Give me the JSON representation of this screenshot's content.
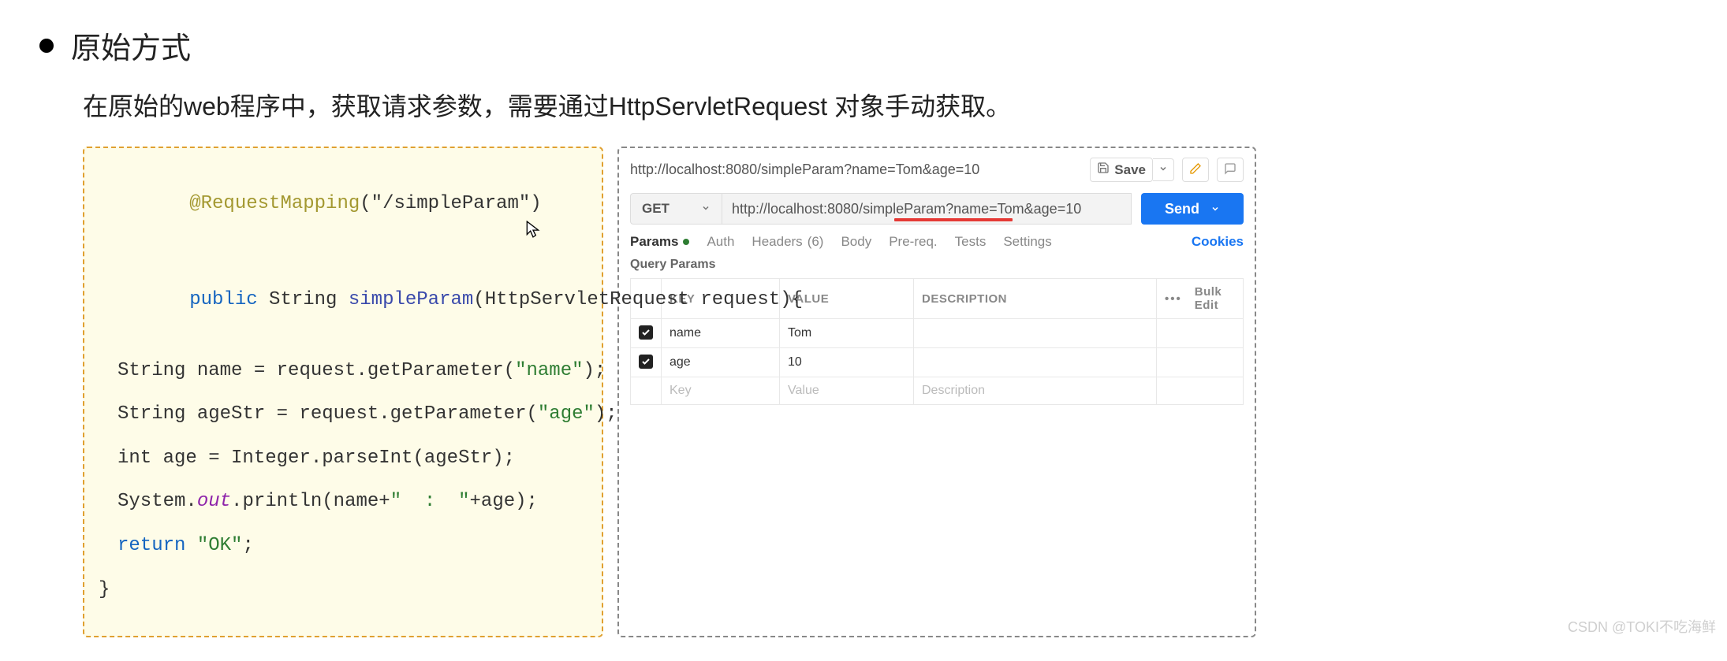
{
  "heading": "原始方式",
  "description": "在原始的web程序中，获取请求参数，需要通过HttpServletRequest 对象手动获取。",
  "code": {
    "annotation": "@RequestMapping",
    "mapping_arg": "(\"/simpleParam\")",
    "kw_public": "public",
    "retType": " String ",
    "fnName": "simpleParam",
    "params": "(HttpServletRequest request){",
    "l3a": "String name = request.getParameter(",
    "l3b": "\"name\"",
    "l3c": ");",
    "l4a": "String ageStr = request.getParameter(",
    "l4b": "\"age\"",
    "l4c": ");",
    "l5": "int age = Integer.parseInt(ageStr);",
    "l6a": "System.",
    "l6b": "out",
    "l6c": ".println(name+",
    "l6d": "\"  :  \"",
    "l6e": "+age);",
    "l7a": "return",
    "l7b": " \"OK\"",
    "l7c": ";",
    "close": "}"
  },
  "api": {
    "title": "http://localhost:8080/simpleParam?name=Tom&age=10",
    "save": "Save",
    "method": "GET",
    "url": "http://localhost:8080/simpleParam?name=Tom&age=10",
    "send": "Send",
    "tabs": {
      "params": "Params",
      "auth": "Auth",
      "headers": "Headers",
      "headers_count": "(6)",
      "body": "Body",
      "prereq": "Pre-req.",
      "tests": "Tests",
      "settings": "Settings"
    },
    "cookies": "Cookies",
    "section": "Query Params",
    "th": {
      "key": "KEY",
      "value": "VALUE",
      "desc": "DESCRIPTION"
    },
    "rows": [
      {
        "checked": true,
        "key": "name",
        "value": "Tom",
        "desc": ""
      },
      {
        "checked": true,
        "key": "age",
        "value": "10",
        "desc": ""
      }
    ],
    "ph": {
      "key": "Key",
      "value": "Value",
      "desc": "Description"
    },
    "bulk": "Bulk Edit"
  },
  "watermark": "CSDN @TOKI不吃海鲜"
}
